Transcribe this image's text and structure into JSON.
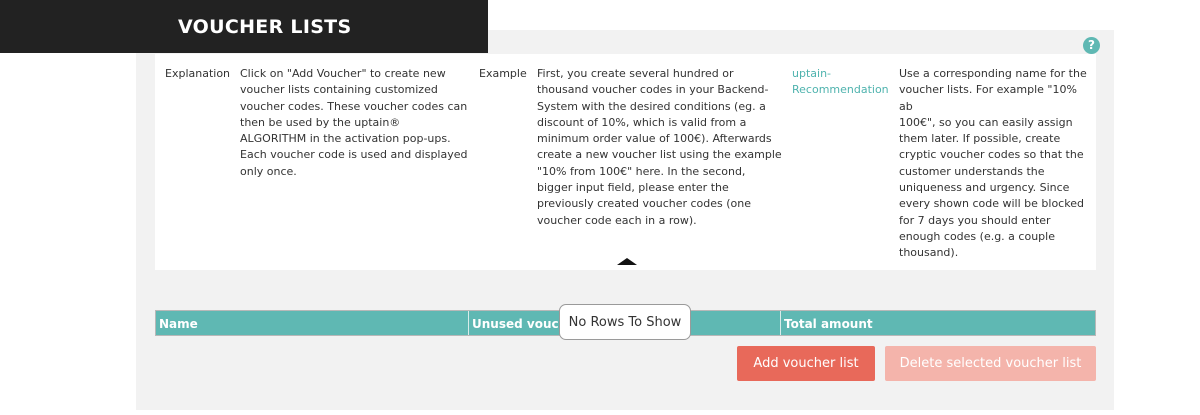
{
  "header": {
    "title": "VOUCHER LISTS"
  },
  "help": {
    "glyph": "?"
  },
  "info": {
    "explanation": {
      "label": "Explanation",
      "lines": [
        "Click on \"Add Voucher\" to create new",
        "voucher lists containing customized",
        "voucher codes. These voucher codes can",
        "then be used by the uptain®",
        "ALGORITHM in the activation pop-ups.",
        "Each voucher code is used and displayed",
        "only once."
      ]
    },
    "example": {
      "label": "Example",
      "lines": [
        "First, you create several hundred or",
        "thousand voucher codes in your Backend-",
        "System with the desired conditions (eg. a",
        "discount of 10%, which is valid from a",
        "minimum order value of 100€). Afterwards",
        "create a new voucher list using the example",
        "\"10% from 100€\" here. In the second,",
        "bigger input field, please enter the",
        "previously created voucher codes (one",
        "voucher code each in a row)."
      ]
    },
    "recommendation": {
      "label_line1": "uptain-",
      "label_line2": "Recommendation",
      "lines": [
        "Use a corresponding name for the",
        "voucher lists. For example \"10% ab",
        "100€\", so you can easily assign",
        "them later. If possible, create",
        "cryptic voucher codes so that the",
        "customer understands the",
        "uniqueness and urgency. Since",
        "every shown code will be blocked",
        "for 7 days you should enter",
        "enough codes (e.g. a couple",
        "thousand)."
      ]
    }
  },
  "grid": {
    "columns": [
      "Name",
      "Unused vouch",
      "Total amount"
    ],
    "empty_message": "No Rows To Show"
  },
  "buttons": {
    "add": "Add voucher list",
    "delete": "Delete selected voucher list"
  },
  "colors": {
    "teal": "#5fb8b3",
    "header_dark": "#222222",
    "add_button": "#e8695a",
    "delete_button_disabled": "#f4b4ab"
  }
}
